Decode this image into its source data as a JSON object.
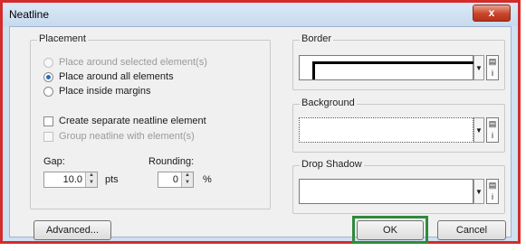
{
  "window": {
    "title": "Neatline",
    "close_glyph": "x"
  },
  "placement": {
    "title": "Placement",
    "options": [
      {
        "label": "Place around selected element(s)",
        "selected": false,
        "enabled": false
      },
      {
        "label": "Place around all elements",
        "selected": true,
        "enabled": true
      },
      {
        "label": "Place inside margins",
        "selected": false,
        "enabled": true
      }
    ],
    "checkboxes": [
      {
        "label": "Create separate neatline element",
        "checked": false,
        "enabled": true
      },
      {
        "label": "Group neatline with element(s)",
        "checked": false,
        "enabled": false
      }
    ],
    "gap": {
      "label": "Gap:",
      "value": "10.0",
      "unit": "pts"
    },
    "rounding": {
      "label": "Rounding:",
      "value": "0",
      "unit": "%"
    }
  },
  "border": {
    "title": "Border"
  },
  "background": {
    "title": "Background"
  },
  "drop_shadow": {
    "title": "Drop Shadow"
  },
  "buttons": {
    "advanced": "Advanced...",
    "ok": "OK",
    "cancel": "Cancel"
  },
  "colors": {
    "highlight_red": "#d42b2b",
    "ok_highlight_green": "#2f8a3c",
    "radio_selected": "#2a6db8"
  },
  "icons": [
    "close-icon",
    "dropdown-arrow-icon",
    "symbol-properties-icon",
    "spin-up-icon",
    "spin-down-icon"
  ]
}
